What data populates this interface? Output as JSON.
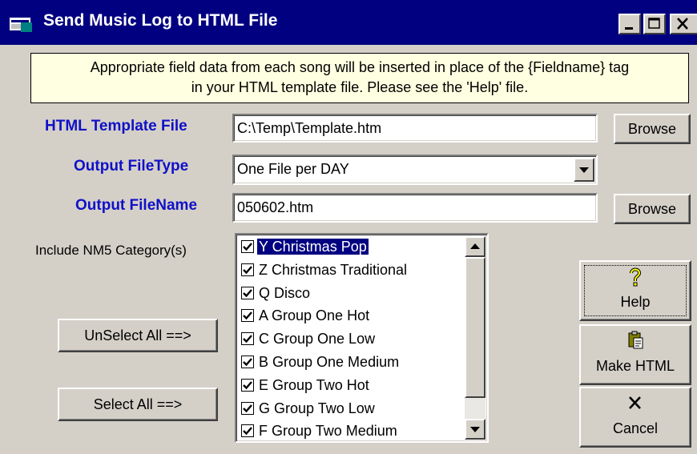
{
  "window": {
    "title": "Send Music Log to HTML File",
    "icon": "app-window-icon",
    "controls": [
      "minimize-icon",
      "maximize-icon",
      "close-icon"
    ]
  },
  "info": {
    "line1": "Appropriate field data from each song will be inserted in place of the {Fieldname} tag",
    "line2": "in your HTML template file. Please see the 'Help' file."
  },
  "fields": {
    "template_label": "HTML Template File",
    "template_value": "C:\\Temp\\Template.htm",
    "type_label": "Output FileType",
    "type_value": "One File per DAY",
    "name_label": "Output FileName",
    "name_value": "050602.htm",
    "include_label": "Include NM5 Category(s)"
  },
  "buttons": {
    "browse_template": "Browse",
    "browse_output": "Browse",
    "unselect_all": "UnSelect All ==>",
    "select_all": "Select All ==>",
    "help": "Help",
    "make_html": "Make HTML",
    "cancel": "Cancel"
  },
  "categories": [
    {
      "code": "Y",
      "name": "Christmas Pop",
      "checked": true,
      "selected": true
    },
    {
      "code": "Z",
      "name": "Christmas Traditional",
      "checked": true
    },
    {
      "code": "Q",
      "name": "Disco",
      "checked": true
    },
    {
      "code": "A",
      "name": "Group One Hot",
      "checked": true
    },
    {
      "code": "C",
      "name": "Group One Low",
      "checked": true
    },
    {
      "code": "B",
      "name": "Group One Medium",
      "checked": true
    },
    {
      "code": "E",
      "name": "Group Two Hot",
      "checked": true
    },
    {
      "code": "G",
      "name": "Group Two Low",
      "checked": true
    },
    {
      "code": "F",
      "name": "Group Two Medium",
      "checked": true
    }
  ],
  "colors": {
    "title_bar": "#000080",
    "label_text": "#1010c8",
    "info_background": "#ffffe1",
    "selection": "#000080",
    "face": "#d4d0c8"
  }
}
